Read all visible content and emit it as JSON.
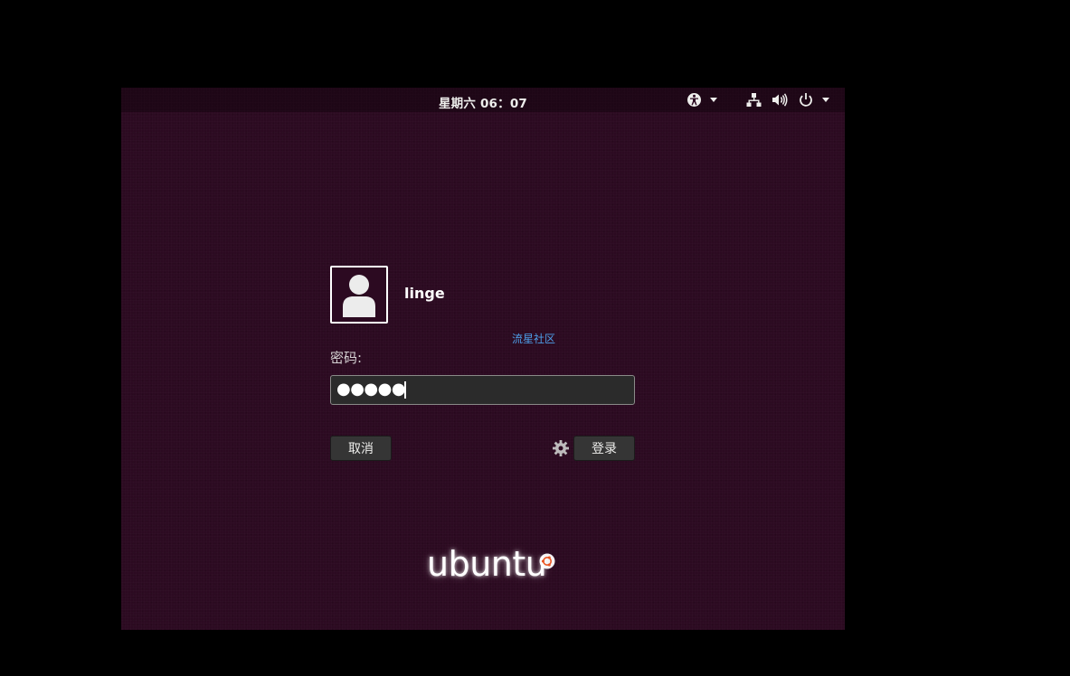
{
  "topbar": {
    "clock": "星期六 06：07",
    "indicators": [
      "accessibility-icon",
      "network-icon",
      "volume-icon",
      "power-icon"
    ]
  },
  "login": {
    "username": "linge",
    "password_label": "密码:",
    "password_value": "●●●●●",
    "cancel_label": "取消",
    "login_label": "登录",
    "session_icon": "gear-icon"
  },
  "watermark": "流星社区",
  "branding": {
    "logo_text": "ubuntu"
  },
  "colors": {
    "background": "#2c0a21",
    "accent_link": "#4d9ee8",
    "button": "#353535"
  }
}
